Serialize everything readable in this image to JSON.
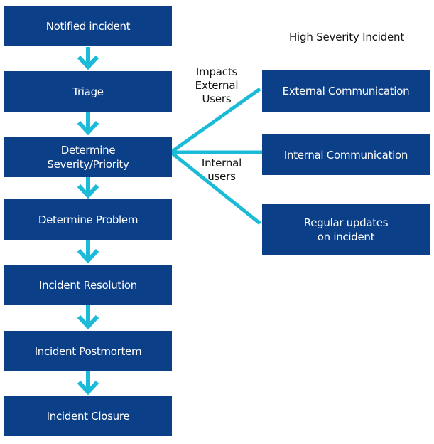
{
  "colors": {
    "box_fill": "#0b3f88",
    "box_text": "#ffffff",
    "connector": "#1bbbd8",
    "label_text": "#111111"
  },
  "flow": {
    "steps": [
      {
        "label": "Notified incident"
      },
      {
        "label": "Triage"
      },
      {
        "label": "Determine\nSeverity/Priority"
      },
      {
        "label": "Determine Problem"
      },
      {
        "label": "Incident Resolution"
      },
      {
        "label": "Incident Postmortem"
      },
      {
        "label": "Incident Closure"
      }
    ]
  },
  "branch": {
    "title": "High Severity Incident",
    "targets": [
      {
        "label": "External Communication"
      },
      {
        "label": "Internal Communication"
      },
      {
        "label": "Regular updates\non incident"
      }
    ],
    "edge_labels": [
      {
        "text": "Impacts\nExternal\nUsers"
      },
      {
        "text": "Internal\nusers"
      }
    ]
  }
}
